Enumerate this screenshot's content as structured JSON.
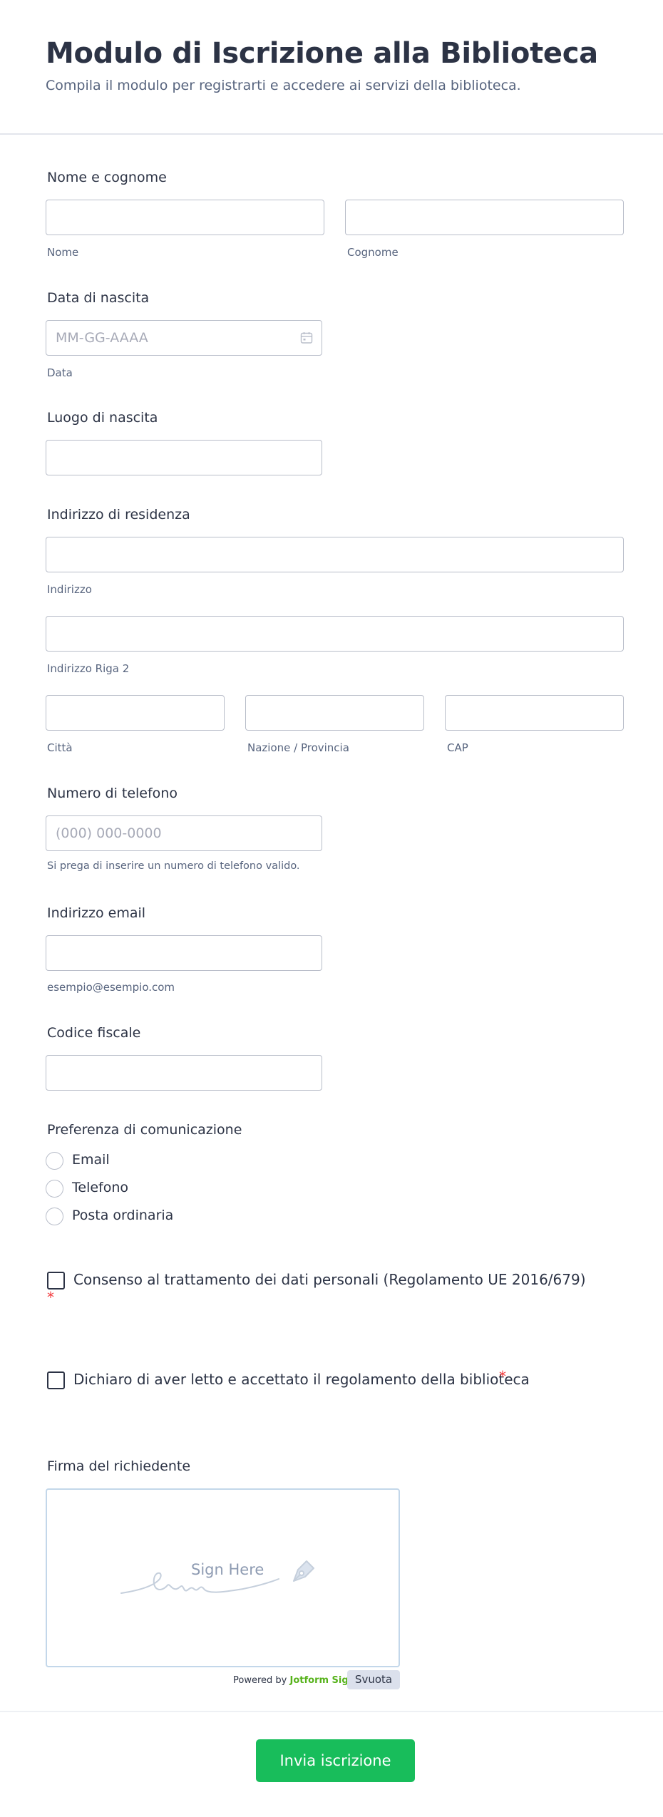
{
  "form": {
    "title": "Modulo di Iscrizione alla Biblioteca",
    "subtitle": "Compila il modulo per registrarti e accedere ai servizi della biblioteca.",
    "full_name": {
      "label": "Nome e cognome",
      "first_value": "",
      "last_value": "",
      "first_sublabel": "Nome",
      "last_sublabel": "Cognome"
    },
    "birth_date": {
      "label": "Data di nascita",
      "placeholder": "MM-GG-AAAA",
      "sublabel": "Data",
      "icon": "calendar-icon"
    },
    "birth_place": {
      "label": "Luogo di nascita",
      "value": ""
    },
    "address": {
      "label": "Indirizzo di residenza",
      "line1_sublabel": "Indirizzo",
      "line2_sublabel": "Indirizzo Riga 2",
      "city_sublabel": "Città",
      "state_sublabel": "Nazione / Provincia",
      "zip_sublabel": "CAP"
    },
    "phone": {
      "label": "Numero di telefono",
      "placeholder": "(000) 000-0000",
      "sublabel": "Si prega di inserire un numero di telefono valido."
    },
    "email": {
      "label": "Indirizzo email",
      "sublabel": "esempio@esempio.com"
    },
    "tax_code": {
      "label": "Codice fiscale"
    },
    "communication": {
      "label": "Preferenza di comunicazione",
      "options": [
        "Email",
        "Telefono",
        "Posta ordinaria"
      ]
    },
    "privacy_consent": {
      "label": "Consenso al trattamento dei dati personali (Regolamento UE 2016/679)",
      "required_mark": "*",
      "checked": false
    },
    "rules_consent": {
      "label": "Dichiaro di aver letto e accettato il regolamento della biblioteca",
      "required_mark": "*",
      "checked": false
    },
    "signature": {
      "label": "Firma del richiedente",
      "placeholder": "Sign Here",
      "powered_prefix": "Powered by",
      "powered_brand": "Jotform Sign",
      "clear_label": "Svuota"
    },
    "submit_label": "Invia iscrizione"
  },
  "colors": {
    "accent": "#18bd5b",
    "required": "#f23a3c",
    "text": "#2c3345",
    "muted": "#57647e",
    "border": "#b8bdc9",
    "brand_green": "#56b21a"
  }
}
